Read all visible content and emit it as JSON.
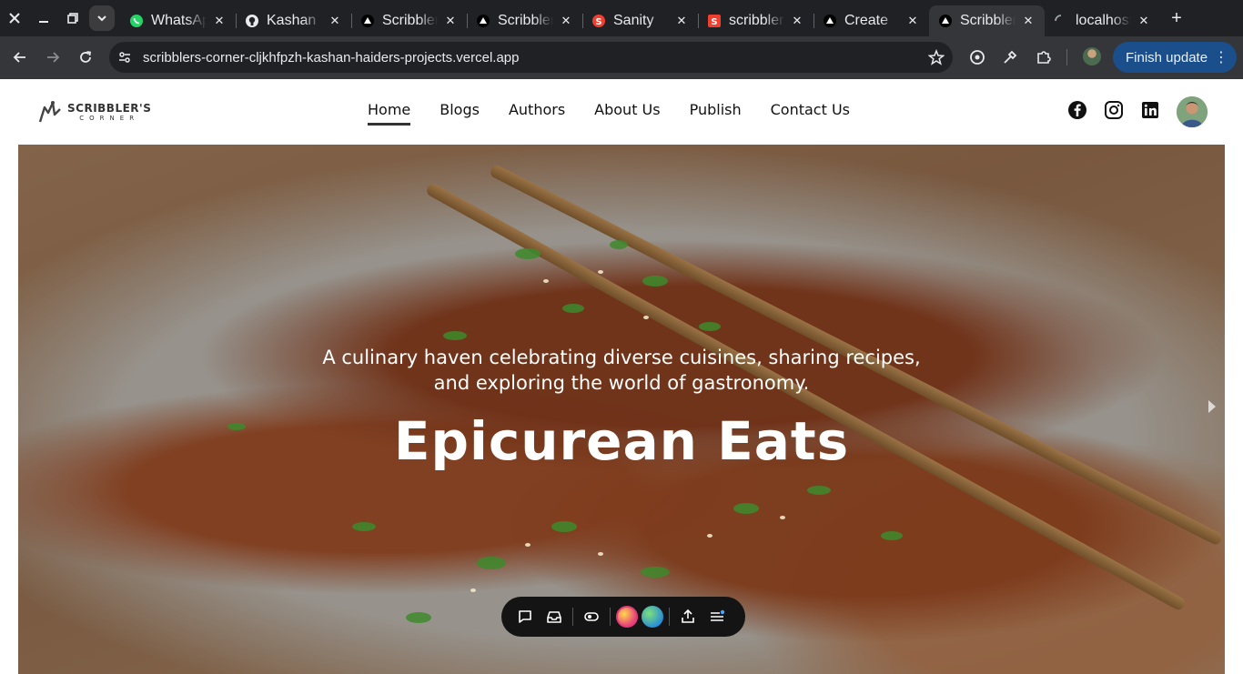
{
  "browser": {
    "tabs": [
      {
        "title": "WhatsApp",
        "icon": "whatsapp-icon",
        "active": false
      },
      {
        "title": "Kashan",
        "icon": "github-icon",
        "active": false
      },
      {
        "title": "Scribblers",
        "icon": "vercel-icon",
        "active": false
      },
      {
        "title": "Scribblers",
        "icon": "vercel-icon",
        "active": false
      },
      {
        "title": "Sanity",
        "icon": "sanity-icon",
        "active": false
      },
      {
        "title": "scribblers",
        "icon": "sanity-square-icon",
        "active": false
      },
      {
        "title": "Create",
        "icon": "vercel-icon",
        "active": false
      },
      {
        "title": "Scribblers",
        "icon": "vercel-icon",
        "active": true
      },
      {
        "title": "localhost",
        "icon": "loading-icon",
        "active": false
      }
    ],
    "url": "scribblers-corner-cljkhfpzh-kashan-haiders-projects.vercel.app",
    "finish_update_label": "Finish update",
    "colors": {
      "tabbar": "#202124",
      "toolbar": "#35363a",
      "update_button": "#1a4f8c"
    }
  },
  "site": {
    "logo": {
      "line1": "SCRIBBLER'S",
      "line2": "CORNER"
    },
    "nav": [
      {
        "label": "Home",
        "active": true
      },
      {
        "label": "Blogs",
        "active": false
      },
      {
        "label": "Authors",
        "active": false
      },
      {
        "label": "About Us",
        "active": false
      },
      {
        "label": "Publish",
        "active": false
      },
      {
        "label": "Contact Us",
        "active": false
      }
    ],
    "socials": [
      "facebook-icon",
      "instagram-icon",
      "linkedin-icon"
    ],
    "hero": {
      "subtitle_line1": "A culinary haven celebrating diverse cuisines, sharing recipes,",
      "subtitle_line2": "and exploring the world of gastronomy.",
      "title": "Epicurean Eats"
    }
  }
}
